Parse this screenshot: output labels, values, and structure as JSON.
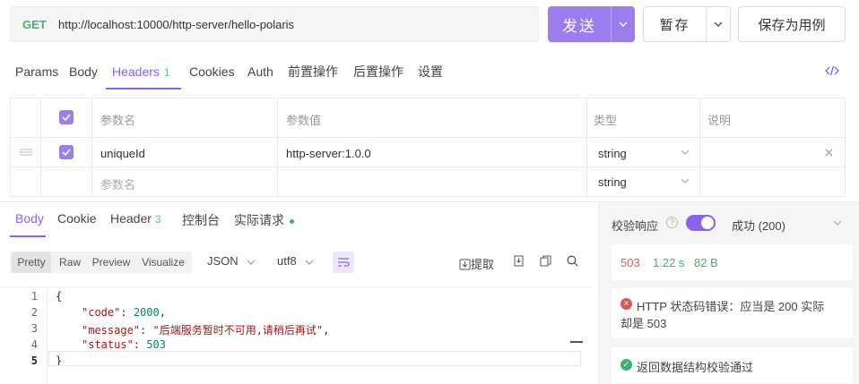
{
  "request": {
    "method": "GET",
    "url": "http://localhost:10000/http-server/hello-polaris",
    "send_label": "发送",
    "save_label": "暂存",
    "save_as_label": "保存为用例"
  },
  "request_tabs": {
    "params": "Params",
    "body": "Body",
    "headers": "Headers",
    "headers_count": "1",
    "cookies": "Cookies",
    "auth": "Auth",
    "pre": "前置操作",
    "post": "后置操作",
    "settings": "设置",
    "active": "Headers"
  },
  "headers_table": {
    "columns": {
      "name": "参数名",
      "value": "参数值",
      "type": "类型",
      "desc": "说明"
    },
    "rows": [
      {
        "name": "uniqueId",
        "value": "http-server:1.0.0",
        "type": "string",
        "checked": true
      }
    ],
    "new_row": {
      "name_placeholder": "参数名",
      "type": "string"
    }
  },
  "response_tabs": {
    "body": "Body",
    "cookie": "Cookie",
    "header": "Header",
    "header_count": "3",
    "console": "控制台",
    "actual": "实际请求",
    "active": "Body"
  },
  "body_toolbar": {
    "views": [
      "Pretty",
      "Raw",
      "Preview",
      "Visualize"
    ],
    "active_view": "Pretty",
    "format": "JSON",
    "encoding": "utf8",
    "extract_label": "提取"
  },
  "response_body": {
    "line_numbers": [
      "1",
      "2",
      "3",
      "4",
      "5"
    ],
    "open_brace": "{",
    "close_brace": "}",
    "code_key": "\"code\"",
    "code_value": "2000",
    "message_key": "\"message\"",
    "message_value": "\"后端服务暂时不可用,请稍后再试\"",
    "status_key": "\"status\"",
    "status_value": "503"
  },
  "validation": {
    "title": "校验响应",
    "enabled": true,
    "selected": "成功 (200)",
    "status_code": "503",
    "time": "1.22 s",
    "size": "82 B",
    "error_line1": "HTTP 状态码错误：应当是 200 实际",
    "error_line2": "却是 503",
    "success_msg": "返回数据结构校验通过"
  },
  "colors": {
    "accent": "#8b62f0",
    "send_bg": "#9d7cf0",
    "method_get": "#3cb371",
    "status_error": "#e05555",
    "status_ok": "#3cb371"
  }
}
